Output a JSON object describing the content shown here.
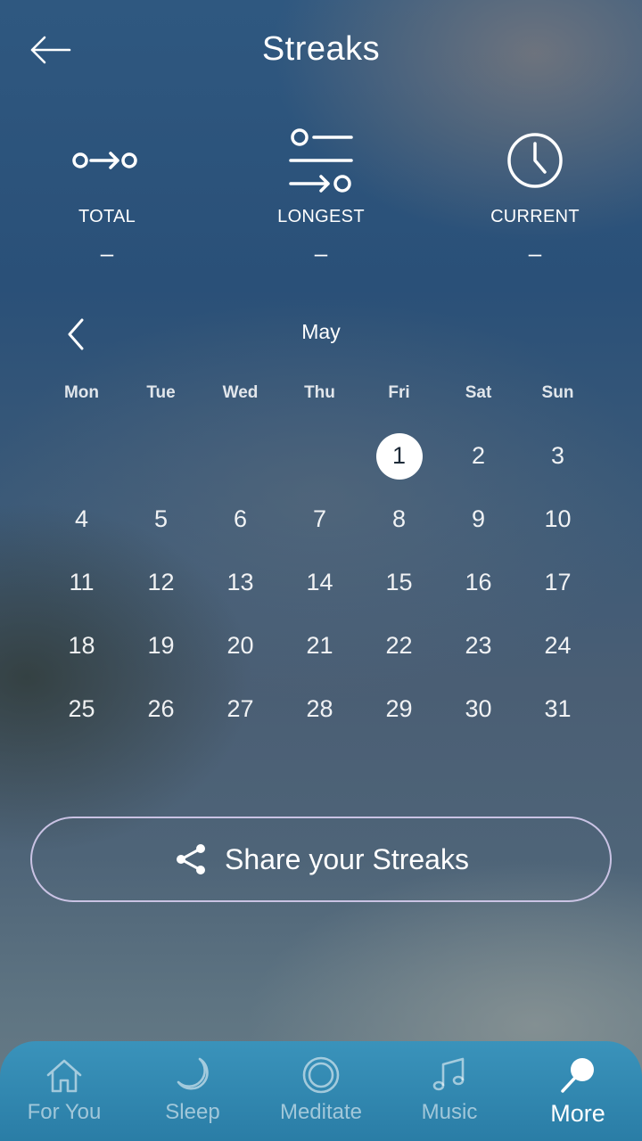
{
  "header": {
    "title": "Streaks"
  },
  "stats": [
    {
      "label": "TOTAL",
      "value": "–",
      "icon": "dots-arrow-icon"
    },
    {
      "label": "LONGEST",
      "value": "–",
      "icon": "list-arrow-icon"
    },
    {
      "label": "CURRENT",
      "value": "–",
      "icon": "clock-icon"
    }
  ],
  "calendar": {
    "month": "May",
    "weekdays": [
      "Mon",
      "Tue",
      "Wed",
      "Thu",
      "Fri",
      "Sat",
      "Sun"
    ],
    "leading_blanks": 4,
    "days": [
      "1",
      "2",
      "3",
      "4",
      "5",
      "6",
      "7",
      "8",
      "9",
      "10",
      "11",
      "12",
      "13",
      "14",
      "15",
      "16",
      "17",
      "18",
      "19",
      "20",
      "21",
      "22",
      "23",
      "24",
      "25",
      "26",
      "27",
      "28",
      "29",
      "30",
      "31"
    ],
    "selected_day": "1"
  },
  "share": {
    "label": "Share your Streaks"
  },
  "tabs": [
    {
      "label": "For You",
      "icon": "house-icon",
      "active": false
    },
    {
      "label": "Sleep",
      "icon": "moon-icon",
      "active": false
    },
    {
      "label": "Meditate",
      "icon": "circle-icon",
      "active": false
    },
    {
      "label": "Music",
      "icon": "music-note-icon",
      "active": false
    },
    {
      "label": "More",
      "icon": "magnifier-icon",
      "active": true
    }
  ]
}
